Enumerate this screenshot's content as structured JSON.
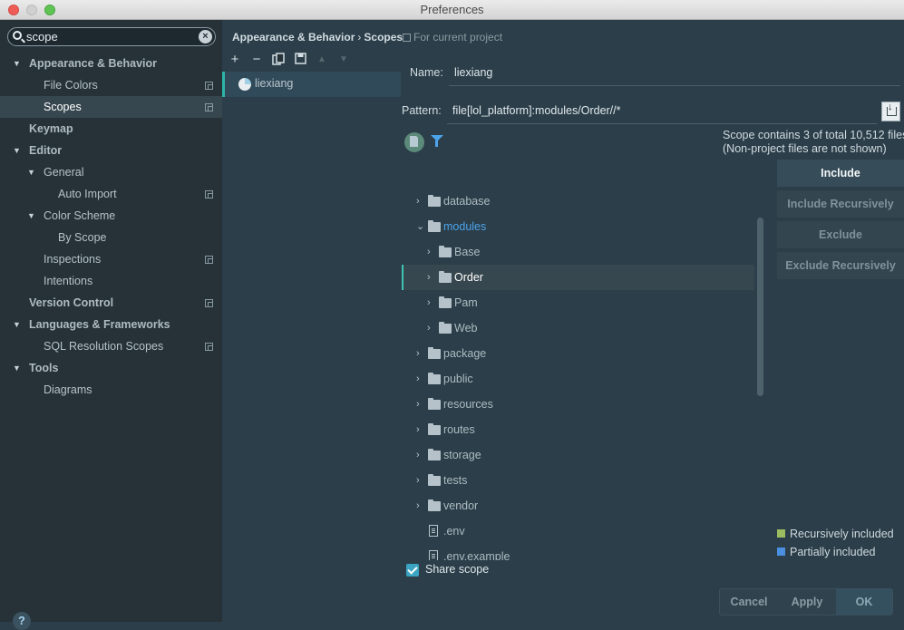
{
  "window": {
    "title": "Preferences"
  },
  "search": {
    "value": "scope"
  },
  "sidebar": {
    "items": [
      {
        "label": "Appearance & Behavior",
        "bold": true,
        "arrow": "▼"
      },
      {
        "label": "File Colors"
      },
      {
        "label": "Scopes",
        "selected": true
      },
      {
        "label": "Keymap",
        "bold": true
      },
      {
        "label": "Editor",
        "bold": true,
        "arrow": "▼"
      },
      {
        "label": "General",
        "arrow": "▼"
      },
      {
        "label": "Auto Import"
      },
      {
        "label": "Color Scheme",
        "arrow": "▼"
      },
      {
        "label": "By Scope"
      },
      {
        "label": "Inspections"
      },
      {
        "label": "Intentions"
      },
      {
        "label": "Version Control",
        "bold": true
      },
      {
        "label": "Languages & Frameworks",
        "bold": true,
        "arrow": "▼"
      },
      {
        "label": "SQL Resolution Scopes"
      },
      {
        "label": "Tools",
        "bold": true,
        "arrow": "▼"
      },
      {
        "label": "Diagrams"
      }
    ],
    "help": "?"
  },
  "breadcrumb": {
    "part1": "Appearance & Behavior",
    "sep": "›",
    "part2": "Scopes",
    "for_project": "For current project"
  },
  "toolbar": {
    "add": "+",
    "remove": "−",
    "up": "▲",
    "down": "▼"
  },
  "scopes": [
    {
      "name": "liexiang"
    }
  ],
  "form": {
    "name_label": "Name:",
    "name_value": "liexiang",
    "pattern_label": "Pattern:",
    "pattern_value": "file[lol_platform]:modules/Order//*"
  },
  "info": {
    "line1": "Scope contains 3 of total 10,512 files",
    "line2": "(Non-project files are not shown)"
  },
  "file_tree": [
    {
      "name": "database",
      "type": "folder",
      "arrow": "›"
    },
    {
      "name": "modules",
      "type": "folder",
      "arrow": "⌄",
      "highlight": true
    },
    {
      "name": "Base",
      "type": "folder",
      "arrow": "›"
    },
    {
      "name": "Order",
      "type": "folder",
      "arrow": "›",
      "selected": true
    },
    {
      "name": "Pam",
      "type": "folder",
      "arrow": "›"
    },
    {
      "name": "Web",
      "type": "folder",
      "arrow": "›"
    },
    {
      "name": "package",
      "type": "folder",
      "arrow": "›"
    },
    {
      "name": "public",
      "type": "folder",
      "arrow": "›"
    },
    {
      "name": "resources",
      "type": "folder",
      "arrow": "›"
    },
    {
      "name": "routes",
      "type": "folder",
      "arrow": "›"
    },
    {
      "name": "storage",
      "type": "folder",
      "arrow": "›"
    },
    {
      "name": "tests",
      "type": "folder",
      "arrow": "›"
    },
    {
      "name": "vendor",
      "type": "folder",
      "arrow": "›"
    },
    {
      "name": ".env",
      "type": "file"
    },
    {
      "name": ".env.example",
      "type": "file"
    }
  ],
  "scope_buttons": {
    "include": "Include",
    "include_recursively": "Include Recursively",
    "exclude": "Exclude",
    "exclude_recursively": "Exclude Recursively"
  },
  "legend": [
    {
      "label": "Recursively included",
      "color": "#9cbd5f"
    },
    {
      "label": "Partially included",
      "color": "#4a8fe0"
    }
  ],
  "share_scope": {
    "label": "Share scope",
    "checked": true
  },
  "dialog_buttons": {
    "cancel": "Cancel",
    "apply": "Apply",
    "ok": "OK"
  }
}
